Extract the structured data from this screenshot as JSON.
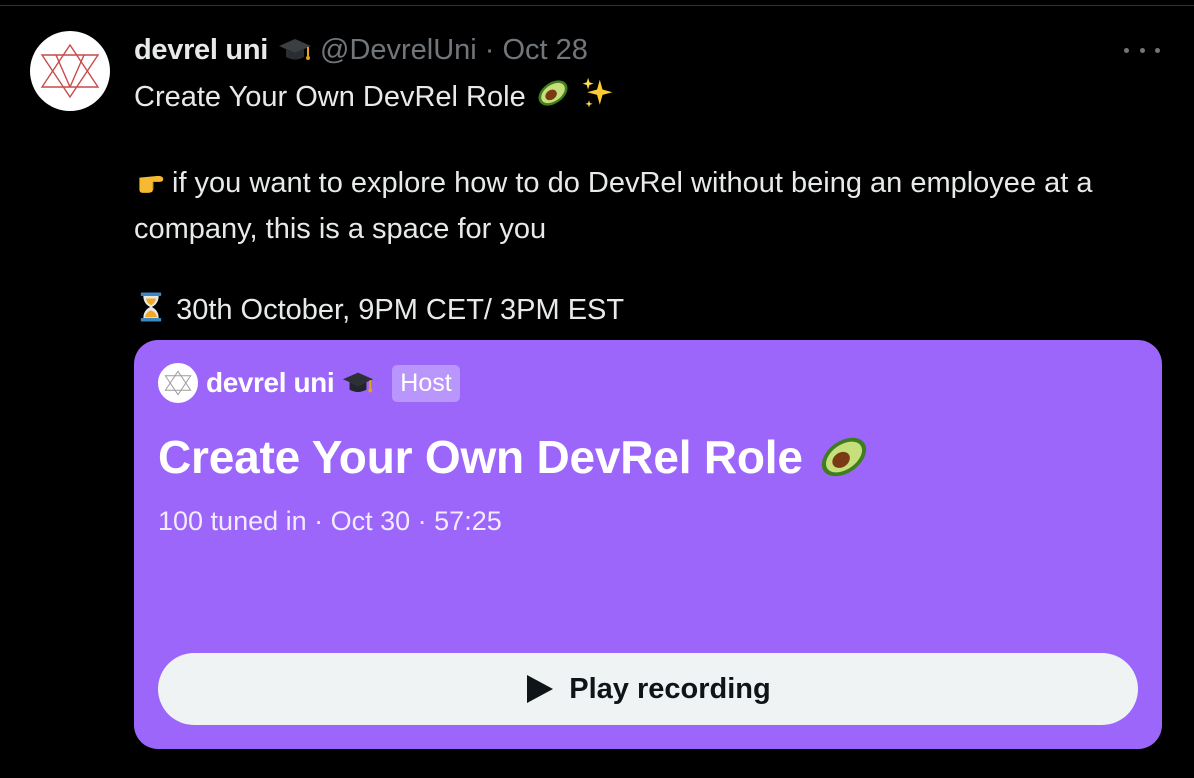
{
  "tweet": {
    "author_name": "devrel uni",
    "handle": "@DevrelUni",
    "separator": "·",
    "date": "Oct 28",
    "line1": "Create Your Own DevRel Role",
    "line2": "if you want to explore how to do DevRel without being an employee at a company, this is a space for you",
    "line3": "30th October, 9PM CET/ 3PM EST"
  },
  "space_card": {
    "host_name": "devrel uni",
    "host_badge": "Host",
    "title": "Create Your Own DevRel Role",
    "meta": "100 tuned in · Oct 30 · 57:25",
    "play_label": "Play recording"
  },
  "colors": {
    "background": "#000000",
    "text": "#e7e9ea",
    "muted": "#71767b",
    "card": "#9c66fb",
    "badge": "#b996fc",
    "button": "#eff3f4"
  },
  "icons": [
    "devrel-uni-logo",
    "graduation-cap-icon",
    "avocado-icon",
    "sparkles-icon",
    "pointing-hand-icon",
    "hourglass-icon",
    "more-icon",
    "play-icon"
  ]
}
